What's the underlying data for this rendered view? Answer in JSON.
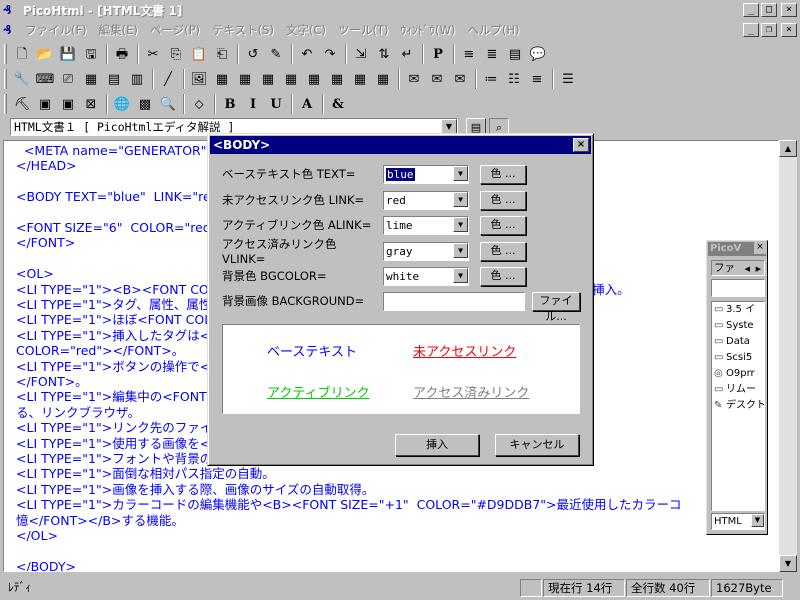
{
  "window": {
    "title": "PicoHtml - [HTML文書 1]",
    "app_icon": "picohtml-icon"
  },
  "menu": [
    "ファイル(F)",
    "編集(E)",
    "ページ(P)",
    "テキスト(S)",
    "文字(C)",
    "ツール(T)",
    "ｳｨﾝﾄﾞｳ(W)",
    "ヘルプ(H)"
  ],
  "window_buttons": {
    "minimize": "_",
    "maximize": "□",
    "restore": "❐",
    "close": "×"
  },
  "toolbar1": [
    "🗋",
    "📂",
    "💾",
    "🖫",
    "🖶",
    "✂",
    "⎘",
    "📋",
    "⎗",
    "↺",
    "✎",
    "↶",
    "↷",
    "⇲",
    "⇅",
    "↵",
    "P",
    "≡",
    "≣",
    "▤",
    "💬"
  ],
  "toolbar2": [
    "🔧",
    "⌨",
    "⎚",
    "▦",
    "▤",
    "▥",
    "╱",
    "🖼",
    "▦",
    "▦",
    "▦",
    "▦",
    "▦",
    "▦",
    "▦",
    "▦",
    "✉",
    "✉",
    "✉",
    "≔",
    "☷",
    "≡",
    "☰"
  ],
  "toolbar3": [
    "⛏",
    "▣",
    "▣",
    "⊠",
    "🌐",
    "▩",
    "🔍",
    "⬦",
    "B",
    "I",
    "U",
    "A",
    "&"
  ],
  "docbar": {
    "selected": "HTML文書１ [ PicoHtmlエディタ解説 ]"
  },
  "editor_lines": [
    "  <META name=\"GENERATOR\" content=\"PicoHtml\">",
    "</HEAD>",
    "",
    "<BODY TEXT=\"blue\"  LINK=\"red\" ALINK=\"lime\">",
    "",
    "<FONT SIZE=\"6\"  COLOR=\"red\">PicoHtml</FONT>",
    "</FONT>",
    "",
    "<OL>",
    "<LI TYPE=\"1\"><B><FONT COLOR=\"red\">タグ</FONT></B>をカーソルのあるカレット位置に挿入。",
    "<LI TYPE=\"1\">タグ、属性、属性値を色分けして<FONT COLOR=\"red\">強調</FONT>で表示。",
    "<LI TYPE=\"1\">ほぼ<FONT COLOR=\"red\">すべて</FONT>のタグに対応。",
    "<LI TYPE=\"1\">挿入したタグは</FONT>ダイアログで編集<I><FONT SIZE=\"+1\"",
    "COLOR=\"red\"></FONT>。",
    "<LI TYPE=\"1\">ボタンの操作で<FONT COLOR=\"black\">ブラウザで",
    "</FONT>。",
    "<LI TYPE=\"1\">編集中の<FONT COLOR=\"red\">HTML</FONT>をリアルタイムで確認</",
    "る、リンクブラウザ。",
    "<LI TYPE=\"1\">リンク先のファイルをブラウザで開いて確認</FONT",
    "<LI TYPE=\"1\">使用する画像を<B>プレビュー</B>で確認しな",
    "<LI TYPE=\"1\">フォントや背景の設定。",
    "<LI TYPE=\"1\">面倒な相対パス指定の自動。",
    "<LI TYPE=\"1\">画像を挿入する際、画像のサイズの自動取得。",
    "<LI TYPE=\"1\">カラーコードの編集機能や<B><FONT SIZE=\"+1\"  COLOR=\"#D9DDB7\">最近使用したカラーコ",
    "憶</FONT></B>する機能。",
    "</OL>",
    "",
    "</BODY>"
  ],
  "statusbar": {
    "ready": "ﾚﾃﾞｨ",
    "current_line": "現在行 14行",
    "total_lines": "全行数 40行",
    "size": "1627Byte"
  },
  "dialog": {
    "title": "<BODY>",
    "close": "×",
    "rows": [
      {
        "label": "ベーステキスト色 TEXT=",
        "value": "blue",
        "button": "色 ..."
      },
      {
        "label": "未アクセスリンク色 LINK=",
        "value": "red",
        "button": "色 ..."
      },
      {
        "label": "アクティブリンク色 ALINK=",
        "value": "lime",
        "button": "色 ..."
      },
      {
        "label": "アクセス済みリンク色 VLINK=",
        "value": "gray",
        "button": "色 ..."
      },
      {
        "label": "背景色 BGCOLOR=",
        "value": "white",
        "button": "色 ..."
      }
    ],
    "background_label": "背景画像  BACKGROUND=",
    "background_value": "",
    "file_button": "ファイル...",
    "preview": {
      "base_text": "ベーステキスト",
      "link": "未アクセスリンク",
      "alink": "アクティブリンク",
      "vlink": "アクセス済みリンク"
    },
    "ok": "挿入",
    "cancel": "キャンセル"
  },
  "picov": {
    "title": "PicoV",
    "tab": "ファ",
    "items": [
      {
        "icon": "▭",
        "label": "3.5 イ"
      },
      {
        "icon": "▭",
        "label": "Syste"
      },
      {
        "icon": "▭",
        "label": "Data"
      },
      {
        "icon": "▭",
        "label": "Scsi5"
      },
      {
        "icon": "◎",
        "label": "O9prr"
      },
      {
        "icon": "▭",
        "label": "リムー"
      },
      {
        "icon": "✎",
        "label": "デスクト"
      }
    ],
    "selector": "HTML"
  },
  "colors": {
    "title_active": "#000080",
    "blue": "#0000ff",
    "red": "#ff0000",
    "lime": "#00cc00",
    "gray": "#808080"
  }
}
